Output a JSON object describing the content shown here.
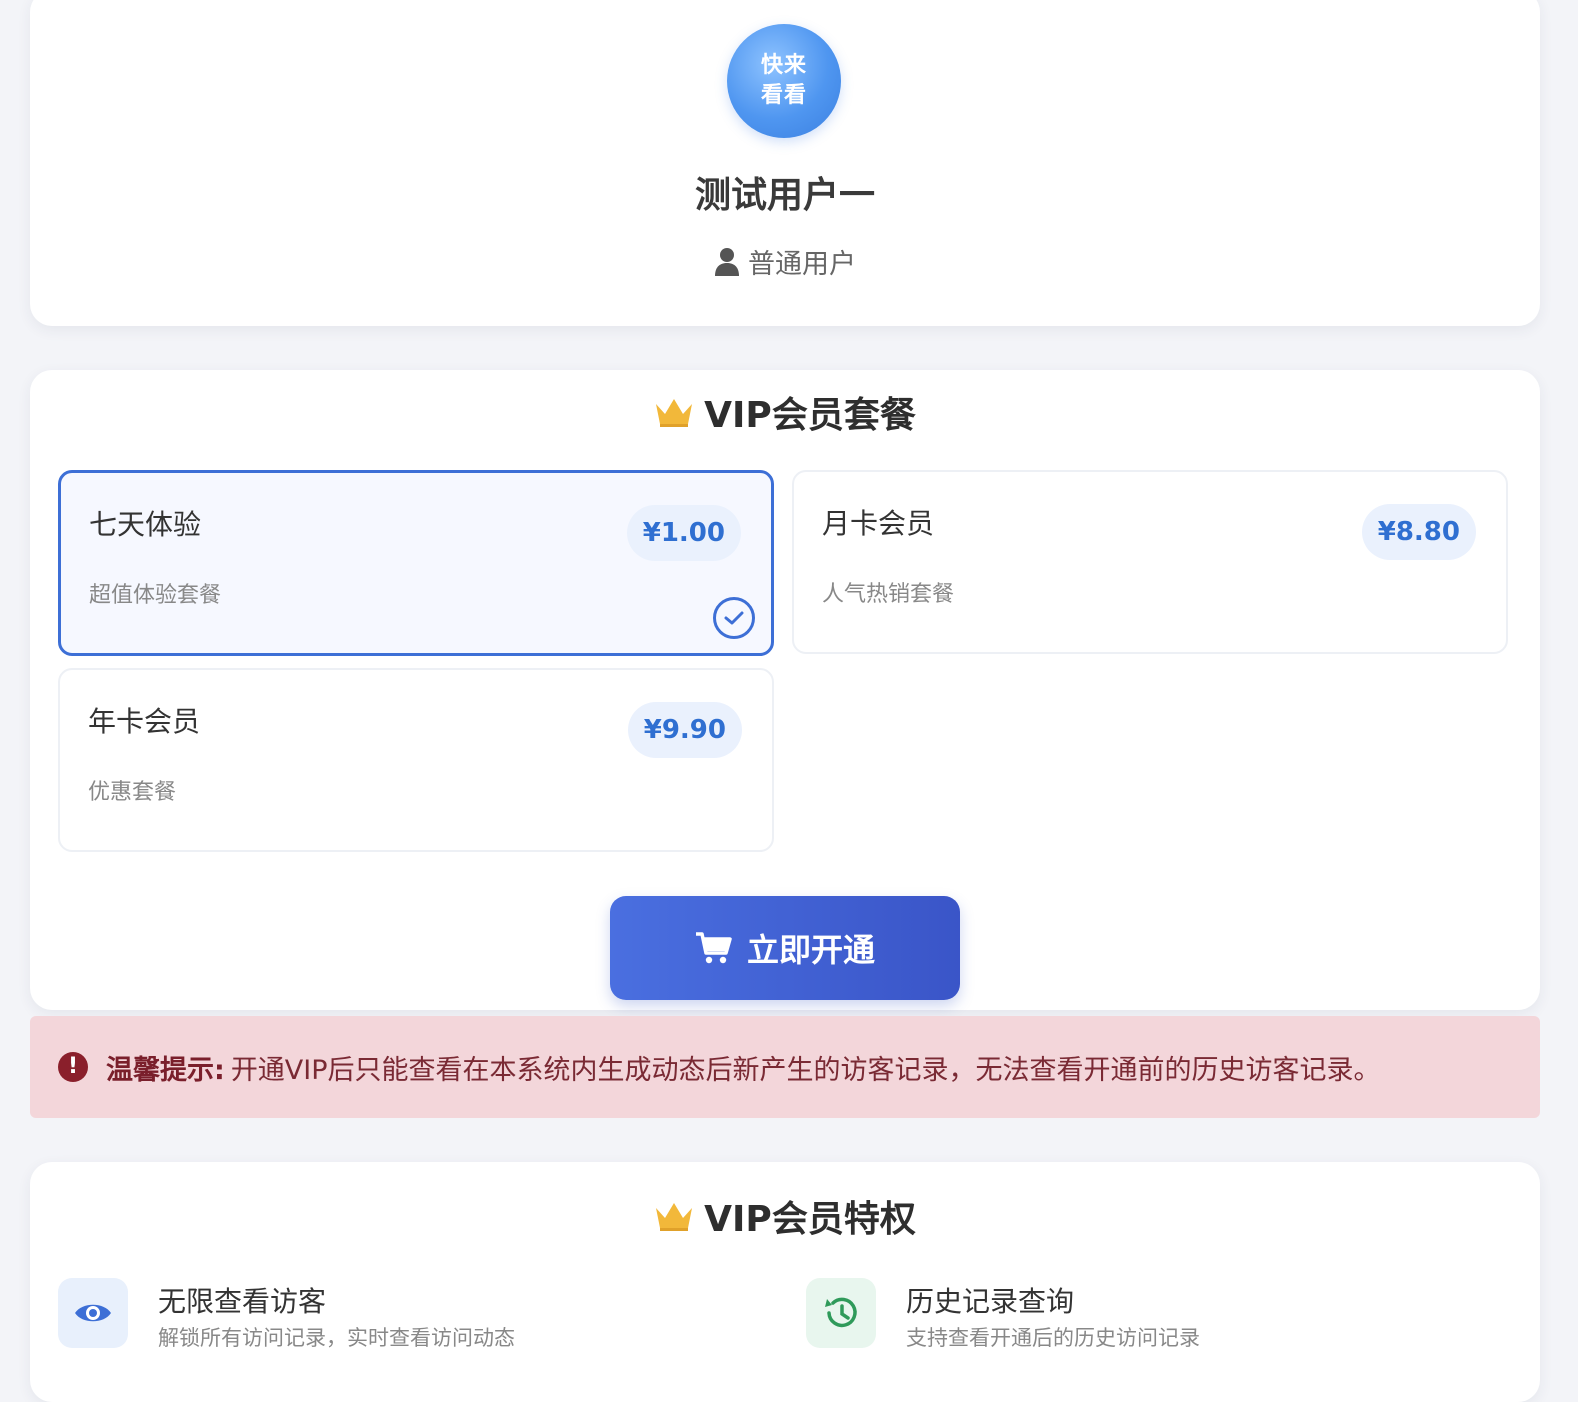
{
  "profile": {
    "avatar_line1": "快来",
    "avatar_line2": "看看",
    "username": "测试用户一",
    "role": "普通用户"
  },
  "plans": {
    "title": "VIP会员套餐",
    "items": [
      {
        "name": "七天体验",
        "desc": "超值体验套餐",
        "price": "¥1.00",
        "selected": true
      },
      {
        "name": "月卡会员",
        "desc": "人气热销套餐",
        "price": "¥8.80",
        "selected": false
      },
      {
        "name": "年卡会员",
        "desc": "优惠套餐",
        "price": "¥9.90",
        "selected": false
      }
    ],
    "buy_label": "立即开通"
  },
  "notice": {
    "label": "温馨提示:",
    "text": "开通VIP后只能查看在本系统内生成动态后新产生的访客记录，无法查看开通前的历史访客记录。"
  },
  "privileges": {
    "title": "VIP会员特权",
    "items": [
      {
        "title": "无限查看访客",
        "desc": "解锁所有访问记录，实时查看访问动态",
        "icon": "eye-icon"
      },
      {
        "title": "历史记录查询",
        "desc": "支持查看开通后的历史访问记录",
        "icon": "history-icon"
      }
    ]
  },
  "colors": {
    "accent": "#3d6fd6",
    "crown": "#f2b83a",
    "notice_bg": "#f3d6da",
    "notice_text": "#7a2a34"
  }
}
